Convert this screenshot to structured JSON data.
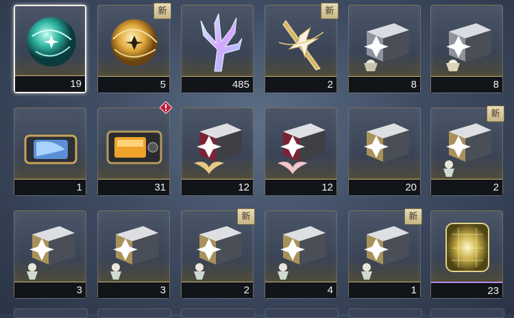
{
  "badge_new_text": "新",
  "items": [
    {
      "id": "orb-teal",
      "count": "19",
      "icon": "teal-orb-icon",
      "new": false,
      "selected": true
    },
    {
      "id": "orb-gold",
      "count": "5",
      "icon": "gold-orb-icon",
      "new": true
    },
    {
      "id": "coral",
      "count": "485",
      "icon": "crystal-coral-icon",
      "new": false
    },
    {
      "id": "sword",
      "count": "2",
      "icon": "gold-blade-icon",
      "new": true
    },
    {
      "id": "crate-1",
      "count": "8",
      "icon": "silver-crate-icon",
      "new": false
    },
    {
      "id": "crate-2",
      "count": "8",
      "icon": "silver-crate-icon",
      "new": false
    },
    {
      "id": "blue-chest",
      "count": "1",
      "icon": "blue-chest-icon",
      "new": false
    },
    {
      "id": "orange-chest",
      "count": "31",
      "icon": "orange-chest-icon",
      "new": false,
      "alert": true
    },
    {
      "id": "red-crate-1",
      "count": "12",
      "icon": "red-crate-icon",
      "new": false
    },
    {
      "id": "red-crate-2",
      "count": "12",
      "icon": "red-crate-icon",
      "new": false
    },
    {
      "id": "crate-3",
      "count": "20",
      "icon": "silver-crate-icon",
      "new": false
    },
    {
      "id": "crate-4",
      "count": "2",
      "icon": "silver-crate-icon",
      "new": true
    },
    {
      "id": "crate-5",
      "count": "3",
      "icon": "silver-crate-icon",
      "new": false
    },
    {
      "id": "crate-6",
      "count": "3",
      "icon": "silver-crate-icon",
      "new": false
    },
    {
      "id": "crate-7",
      "count": "2",
      "icon": "silver-crate-icon",
      "new": true
    },
    {
      "id": "crate-8",
      "count": "4",
      "icon": "silver-crate-icon",
      "new": false
    },
    {
      "id": "crate-9",
      "count": "1",
      "icon": "silver-crate-icon",
      "new": true
    },
    {
      "id": "gold-cube",
      "count": "23",
      "icon": "gold-cube-icon",
      "new": false,
      "purple": true
    }
  ],
  "colors": {
    "count_bar": "#111419",
    "gold_line": "#c9b67a",
    "purple_line": "#b88cf0",
    "alert": "#c0213a"
  }
}
